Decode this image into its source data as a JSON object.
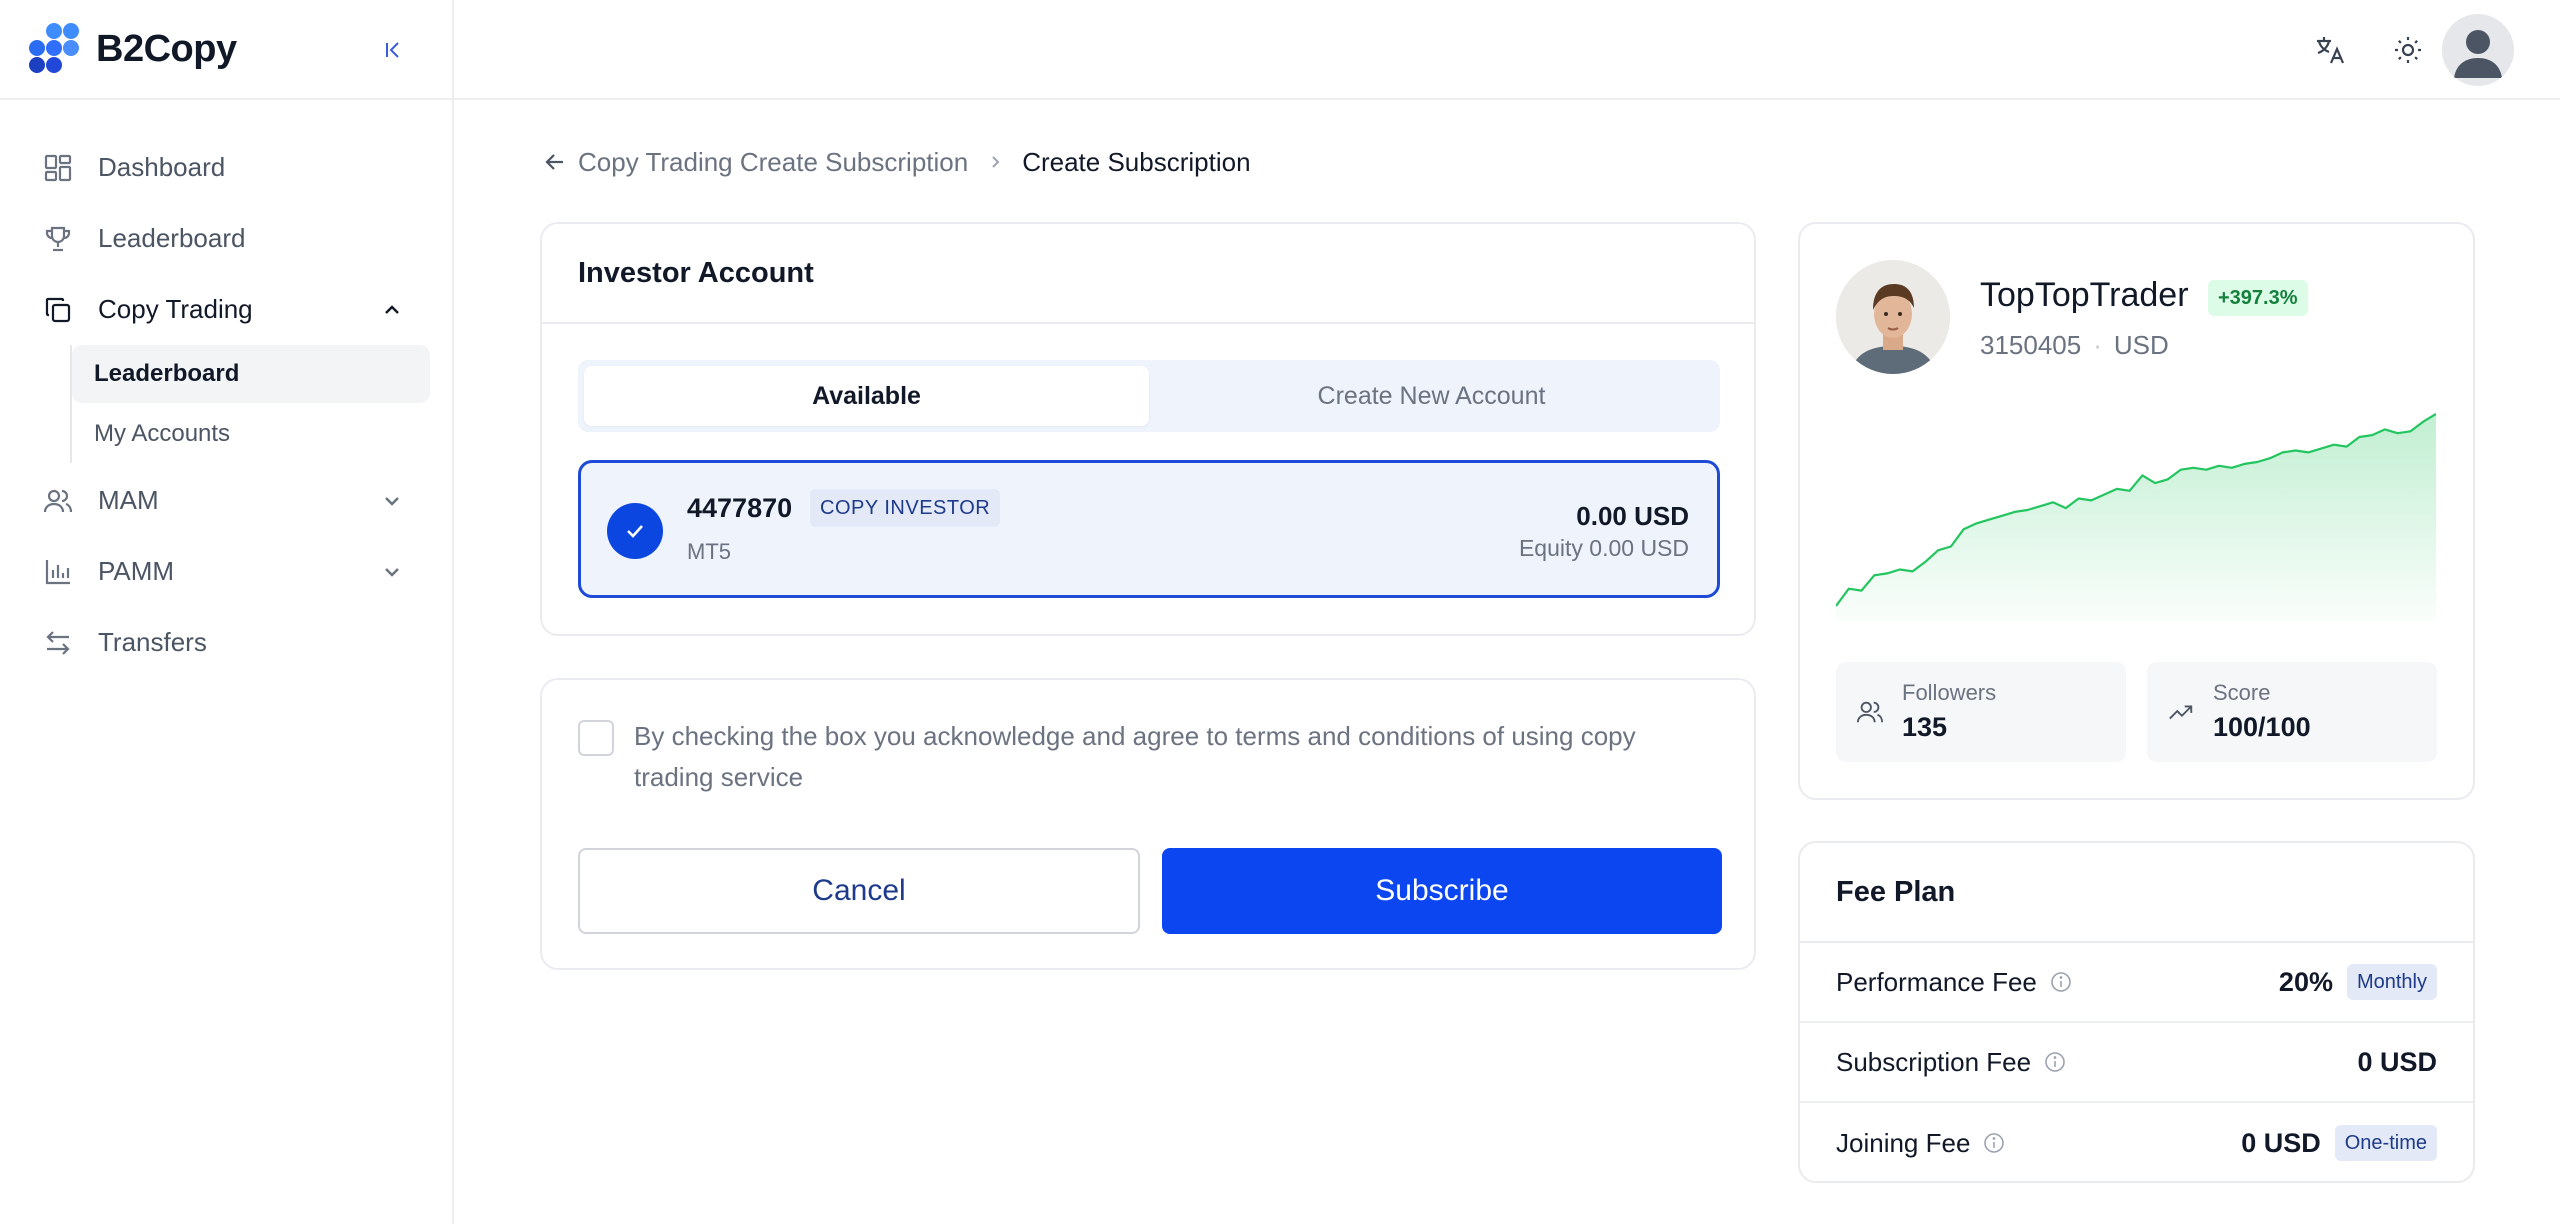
{
  "app": {
    "name": "B2Copy"
  },
  "sidebar": {
    "items": [
      {
        "label": "Dashboard"
      },
      {
        "label": "Leaderboard"
      },
      {
        "label": "Copy Trading"
      },
      {
        "label": "MAM"
      },
      {
        "label": "PAMM"
      },
      {
        "label": "Transfers"
      }
    ],
    "copy_trading_sub": [
      {
        "label": "Leaderboard"
      },
      {
        "label": "My Accounts"
      }
    ]
  },
  "breadcrumb": {
    "parent": "Copy Trading Create Subscription",
    "current": "Create Subscription"
  },
  "investor": {
    "title": "Investor Account",
    "tabs": [
      {
        "label": "Available"
      },
      {
        "label": "Create New Account"
      }
    ],
    "account": {
      "number": "4477870",
      "badge": "COPY INVESTOR",
      "platform": "MT5",
      "balance": "0.00 USD",
      "equity": "Equity 0.00 USD"
    }
  },
  "terms": {
    "text": "By checking the box you acknowledge and agree to terms and conditions of using copy trading service",
    "cancel_label": "Cancel",
    "subscribe_label": "Subscribe"
  },
  "trader": {
    "name": "TopTopTrader",
    "return_badge": "+397.3%",
    "account_id": "3150405",
    "separator": "·",
    "currency": "USD",
    "followers_label": "Followers",
    "followers_value": "135",
    "score_label": "Score",
    "score_value": "100/100"
  },
  "chart_data": {
    "type": "area",
    "title": "",
    "xlabel": "",
    "ylabel": "",
    "grid": false,
    "color": "#22c55e",
    "values": [
      0,
      9,
      8,
      16,
      17,
      19,
      18,
      23,
      29,
      31,
      40,
      43,
      45,
      47,
      49,
      50,
      52,
      54,
      51,
      56,
      55,
      58,
      61,
      60,
      68,
      64,
      66,
      71,
      72,
      71,
      73,
      72,
      74,
      75,
      77,
      80,
      81,
      80,
      82,
      84,
      83,
      88,
      89,
      92,
      90,
      91,
      96,
      100
    ]
  },
  "fees": {
    "title": "Fee Plan",
    "rows": [
      {
        "label": "Performance Fee",
        "value": "20%",
        "badge": "Monthly"
      },
      {
        "label": "Subscription Fee",
        "value": "0 USD",
        "badge": ""
      },
      {
        "label": "Joining Fee",
        "value": "0 USD",
        "badge": "One-time"
      }
    ]
  },
  "colors": {
    "primary": "#0b46f0",
    "positive": "#15803d",
    "selected_bg": "#eef3fc"
  },
  "icons": {
    "header": [
      "translate-icon",
      "sun-icon",
      "user-avatar-icon"
    ],
    "sidebar": [
      "dashboard-icon",
      "trophy-icon",
      "copy-icon",
      "users-icon",
      "bar-chart-icon",
      "transfer-icon"
    ]
  }
}
